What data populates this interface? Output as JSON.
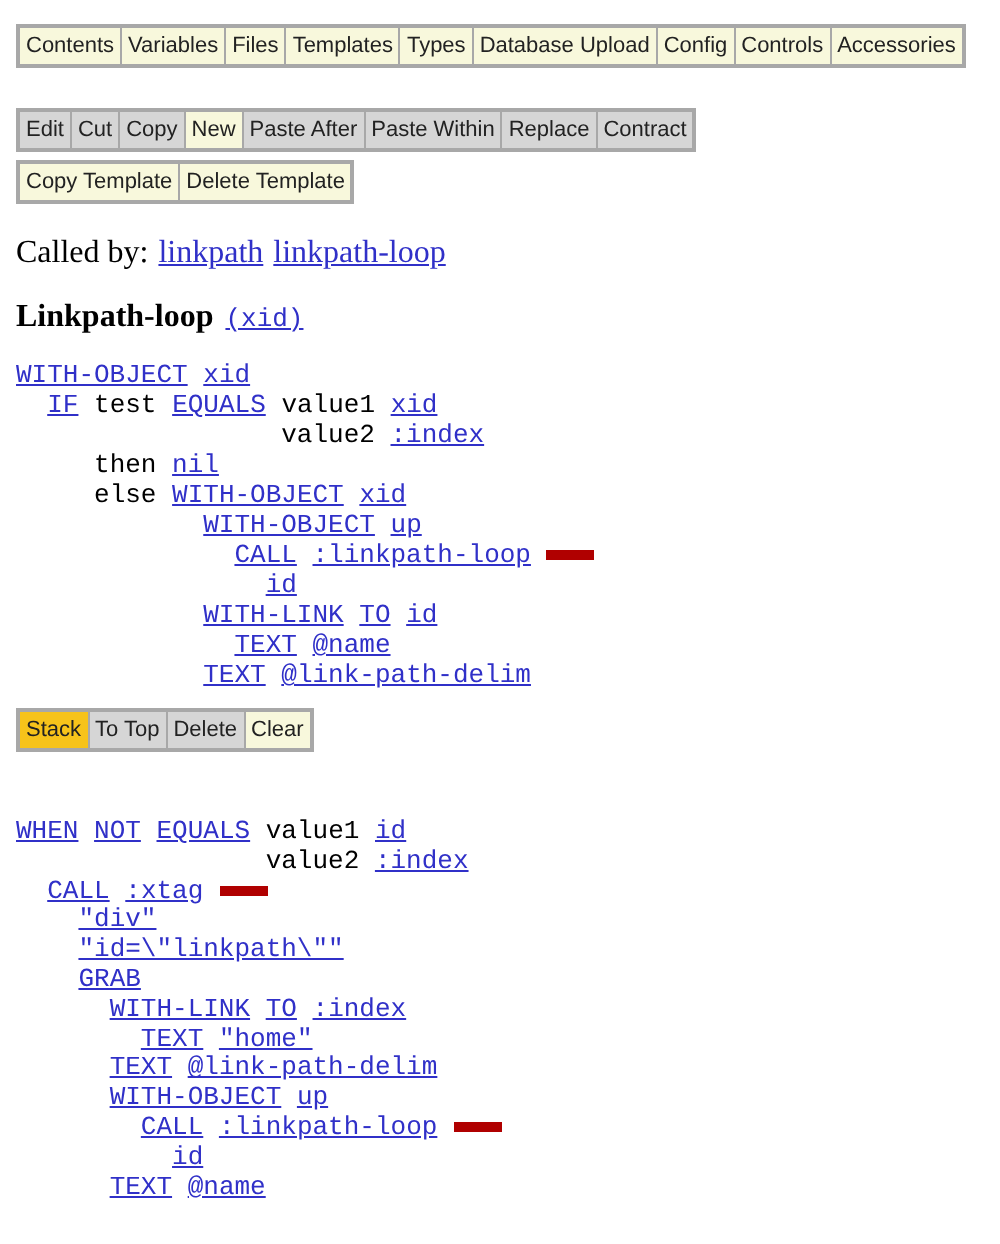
{
  "menu_bar": [
    {
      "label": "Contents",
      "enabled": true
    },
    {
      "label": "Variables",
      "enabled": true
    },
    {
      "label": "Files",
      "enabled": true
    },
    {
      "label": "Templates",
      "enabled": true
    },
    {
      "label": "Types",
      "enabled": true
    },
    {
      "label": "Database Upload",
      "enabled": true
    },
    {
      "label": "Config",
      "enabled": true
    },
    {
      "label": "Controls",
      "enabled": true
    },
    {
      "label": "Accessories",
      "enabled": true
    }
  ],
  "edit_toolbar": [
    {
      "label": "Edit",
      "enabled": false
    },
    {
      "label": "Cut",
      "enabled": false
    },
    {
      "label": "Copy",
      "enabled": false
    },
    {
      "label": "New",
      "enabled": true
    },
    {
      "label": "Paste After",
      "enabled": false
    },
    {
      "label": "Paste Within",
      "enabled": false
    },
    {
      "label": "Replace",
      "enabled": false
    },
    {
      "label": "Contract",
      "enabled": false
    }
  ],
  "template_toolbar": [
    {
      "label": "Copy Template",
      "enabled": true
    },
    {
      "label": "Delete Template",
      "enabled": true
    }
  ],
  "called_by": {
    "label": "Called by:",
    "links": [
      "linkpath",
      "linkpath-loop"
    ]
  },
  "template": {
    "name": "Linkpath-loop",
    "params": "(xid)"
  },
  "code": [
    {
      "flag": false,
      "tokens": [
        {
          "text": "WITH-OBJECT",
          "kind": "link"
        },
        {
          "text": "xid",
          "kind": "link"
        }
      ],
      "children": [
        {
          "kind": "child",
          "flag": false,
          "tokens": [
            {
              "text": "IF",
              "kind": "link"
            },
            {
              "text": "test",
              "kind": "text"
            },
            {
              "text": "EQUALS",
              "kind": "link"
            },
            {
              "text": "value1",
              "kind": "text"
            },
            {
              "text": "xid",
              "kind": "link"
            }
          ],
          "children": [
            {
              "kind": "continuation",
              "flag": false,
              "tokens": [
                {
                  "text": "value2",
                  "kind": "text"
                },
                {
                  "text": ":index",
                  "kind": "link"
                }
              ]
            },
            {
              "kind": "clause",
              "flag": false,
              "tokens": [
                {
                  "text": "then",
                  "kind": "text"
                },
                {
                  "text": "nil",
                  "kind": "link"
                }
              ]
            },
            {
              "kind": "clause",
              "flag": false,
              "tokens": [
                {
                  "text": "else",
                  "kind": "text"
                },
                {
                  "text": "WITH-OBJECT",
                  "kind": "link"
                },
                {
                  "text": "xid",
                  "kind": "link"
                }
              ],
              "children": [
                {
                  "kind": "child",
                  "flag": false,
                  "tokens": [
                    {
                      "text": "WITH-OBJECT",
                      "kind": "link"
                    },
                    {
                      "text": "up",
                      "kind": "link"
                    }
                  ],
                  "children": [
                    {
                      "kind": "child",
                      "flag": true,
                      "tokens": [
                        {
                          "text": "CALL",
                          "kind": "link"
                        },
                        {
                          "text": ":linkpath-loop",
                          "kind": "link"
                        }
                      ],
                      "children": [
                        {
                          "kind": "child",
                          "flag": false,
                          "tokens": [
                            {
                              "text": "id",
                              "kind": "link"
                            }
                          ]
                        }
                      ]
                    }
                  ]
                },
                {
                  "kind": "child",
                  "flag": false,
                  "tokens": [
                    {
                      "text": "WITH-LINK",
                      "kind": "link"
                    },
                    {
                      "text": "TO",
                      "kind": "link"
                    },
                    {
                      "text": "id",
                      "kind": "link"
                    }
                  ],
                  "children": [
                    {
                      "kind": "child",
                      "flag": false,
                      "tokens": [
                        {
                          "text": "TEXT",
                          "kind": "link"
                        },
                        {
                          "text": "@name",
                          "kind": "link"
                        }
                      ]
                    }
                  ]
                },
                {
                  "kind": "child",
                  "flag": false,
                  "tokens": [
                    {
                      "text": "TEXT",
                      "kind": "link"
                    },
                    {
                      "text": "@link-path-delim",
                      "kind": "link"
                    }
                  ]
                }
              ]
            }
          ]
        }
      ]
    }
  ],
  "stack_toolbar": [
    {
      "label": "Stack",
      "enabled": true,
      "selected": true
    },
    {
      "label": "To Top",
      "enabled": false,
      "selected": false
    },
    {
      "label": "Delete",
      "enabled": false,
      "selected": false
    },
    {
      "label": "Clear",
      "enabled": true,
      "selected": false
    }
  ],
  "stack_code": [
    {
      "flag": false,
      "tokens": [
        {
          "text": "WHEN",
          "kind": "link"
        },
        {
          "text": "NOT",
          "kind": "link"
        },
        {
          "text": "EQUALS",
          "kind": "link"
        },
        {
          "text": "value1",
          "kind": "text"
        },
        {
          "text": "id",
          "kind": "link"
        }
      ],
      "children": [
        {
          "kind": "continuation",
          "flag": false,
          "tokens": [
            {
              "text": "value2",
              "kind": "text"
            },
            {
              "text": ":index",
              "kind": "link"
            }
          ]
        },
        {
          "kind": "child",
          "flag": true,
          "tokens": [
            {
              "text": "CALL",
              "kind": "link"
            },
            {
              "text": ":xtag",
              "kind": "link"
            }
          ],
          "children": [
            {
              "kind": "child",
              "flag": false,
              "tokens": [
                {
                  "text": "\"div\"",
                  "kind": "link"
                }
              ]
            },
            {
              "kind": "child",
              "flag": false,
              "tokens": [
                {
                  "text": "\"id=\\\"linkpath\\\"\"",
                  "kind": "link"
                }
              ]
            },
            {
              "kind": "child",
              "flag": false,
              "tokens": [
                {
                  "text": "GRAB",
                  "kind": "link"
                }
              ],
              "children": [
                {
                  "kind": "child",
                  "flag": false,
                  "tokens": [
                    {
                      "text": "WITH-LINK",
                      "kind": "link"
                    },
                    {
                      "text": "TO",
                      "kind": "link"
                    },
                    {
                      "text": ":index",
                      "kind": "link"
                    }
                  ],
                  "children": [
                    {
                      "kind": "child",
                      "flag": false,
                      "tokens": [
                        {
                          "text": "TEXT",
                          "kind": "link"
                        },
                        {
                          "text": "\"home\"",
                          "kind": "link"
                        }
                      ]
                    }
                  ]
                },
                {
                  "kind": "child",
                  "flag": false,
                  "tokens": [
                    {
                      "text": "TEXT",
                      "kind": "link"
                    },
                    {
                      "text": "@link-path-delim",
                      "kind": "link"
                    }
                  ]
                },
                {
                  "kind": "child",
                  "flag": false,
                  "tokens": [
                    {
                      "text": "WITH-OBJECT",
                      "kind": "link"
                    },
                    {
                      "text": "up",
                      "kind": "link"
                    }
                  ],
                  "children": [
                    {
                      "kind": "child",
                      "flag": true,
                      "tokens": [
                        {
                          "text": "CALL",
                          "kind": "link"
                        },
                        {
                          "text": ":linkpath-loop",
                          "kind": "link"
                        }
                      ],
                      "children": [
                        {
                          "kind": "child",
                          "flag": false,
                          "tokens": [
                            {
                              "text": "id",
                              "kind": "link"
                            }
                          ]
                        }
                      ]
                    }
                  ]
                },
                {
                  "kind": "child",
                  "flag": false,
                  "tokens": [
                    {
                      "text": "TEXT",
                      "kind": "link"
                    },
                    {
                      "text": "@name",
                      "kind": "link"
                    }
                  ]
                }
              ]
            }
          ]
        }
      ]
    }
  ]
}
